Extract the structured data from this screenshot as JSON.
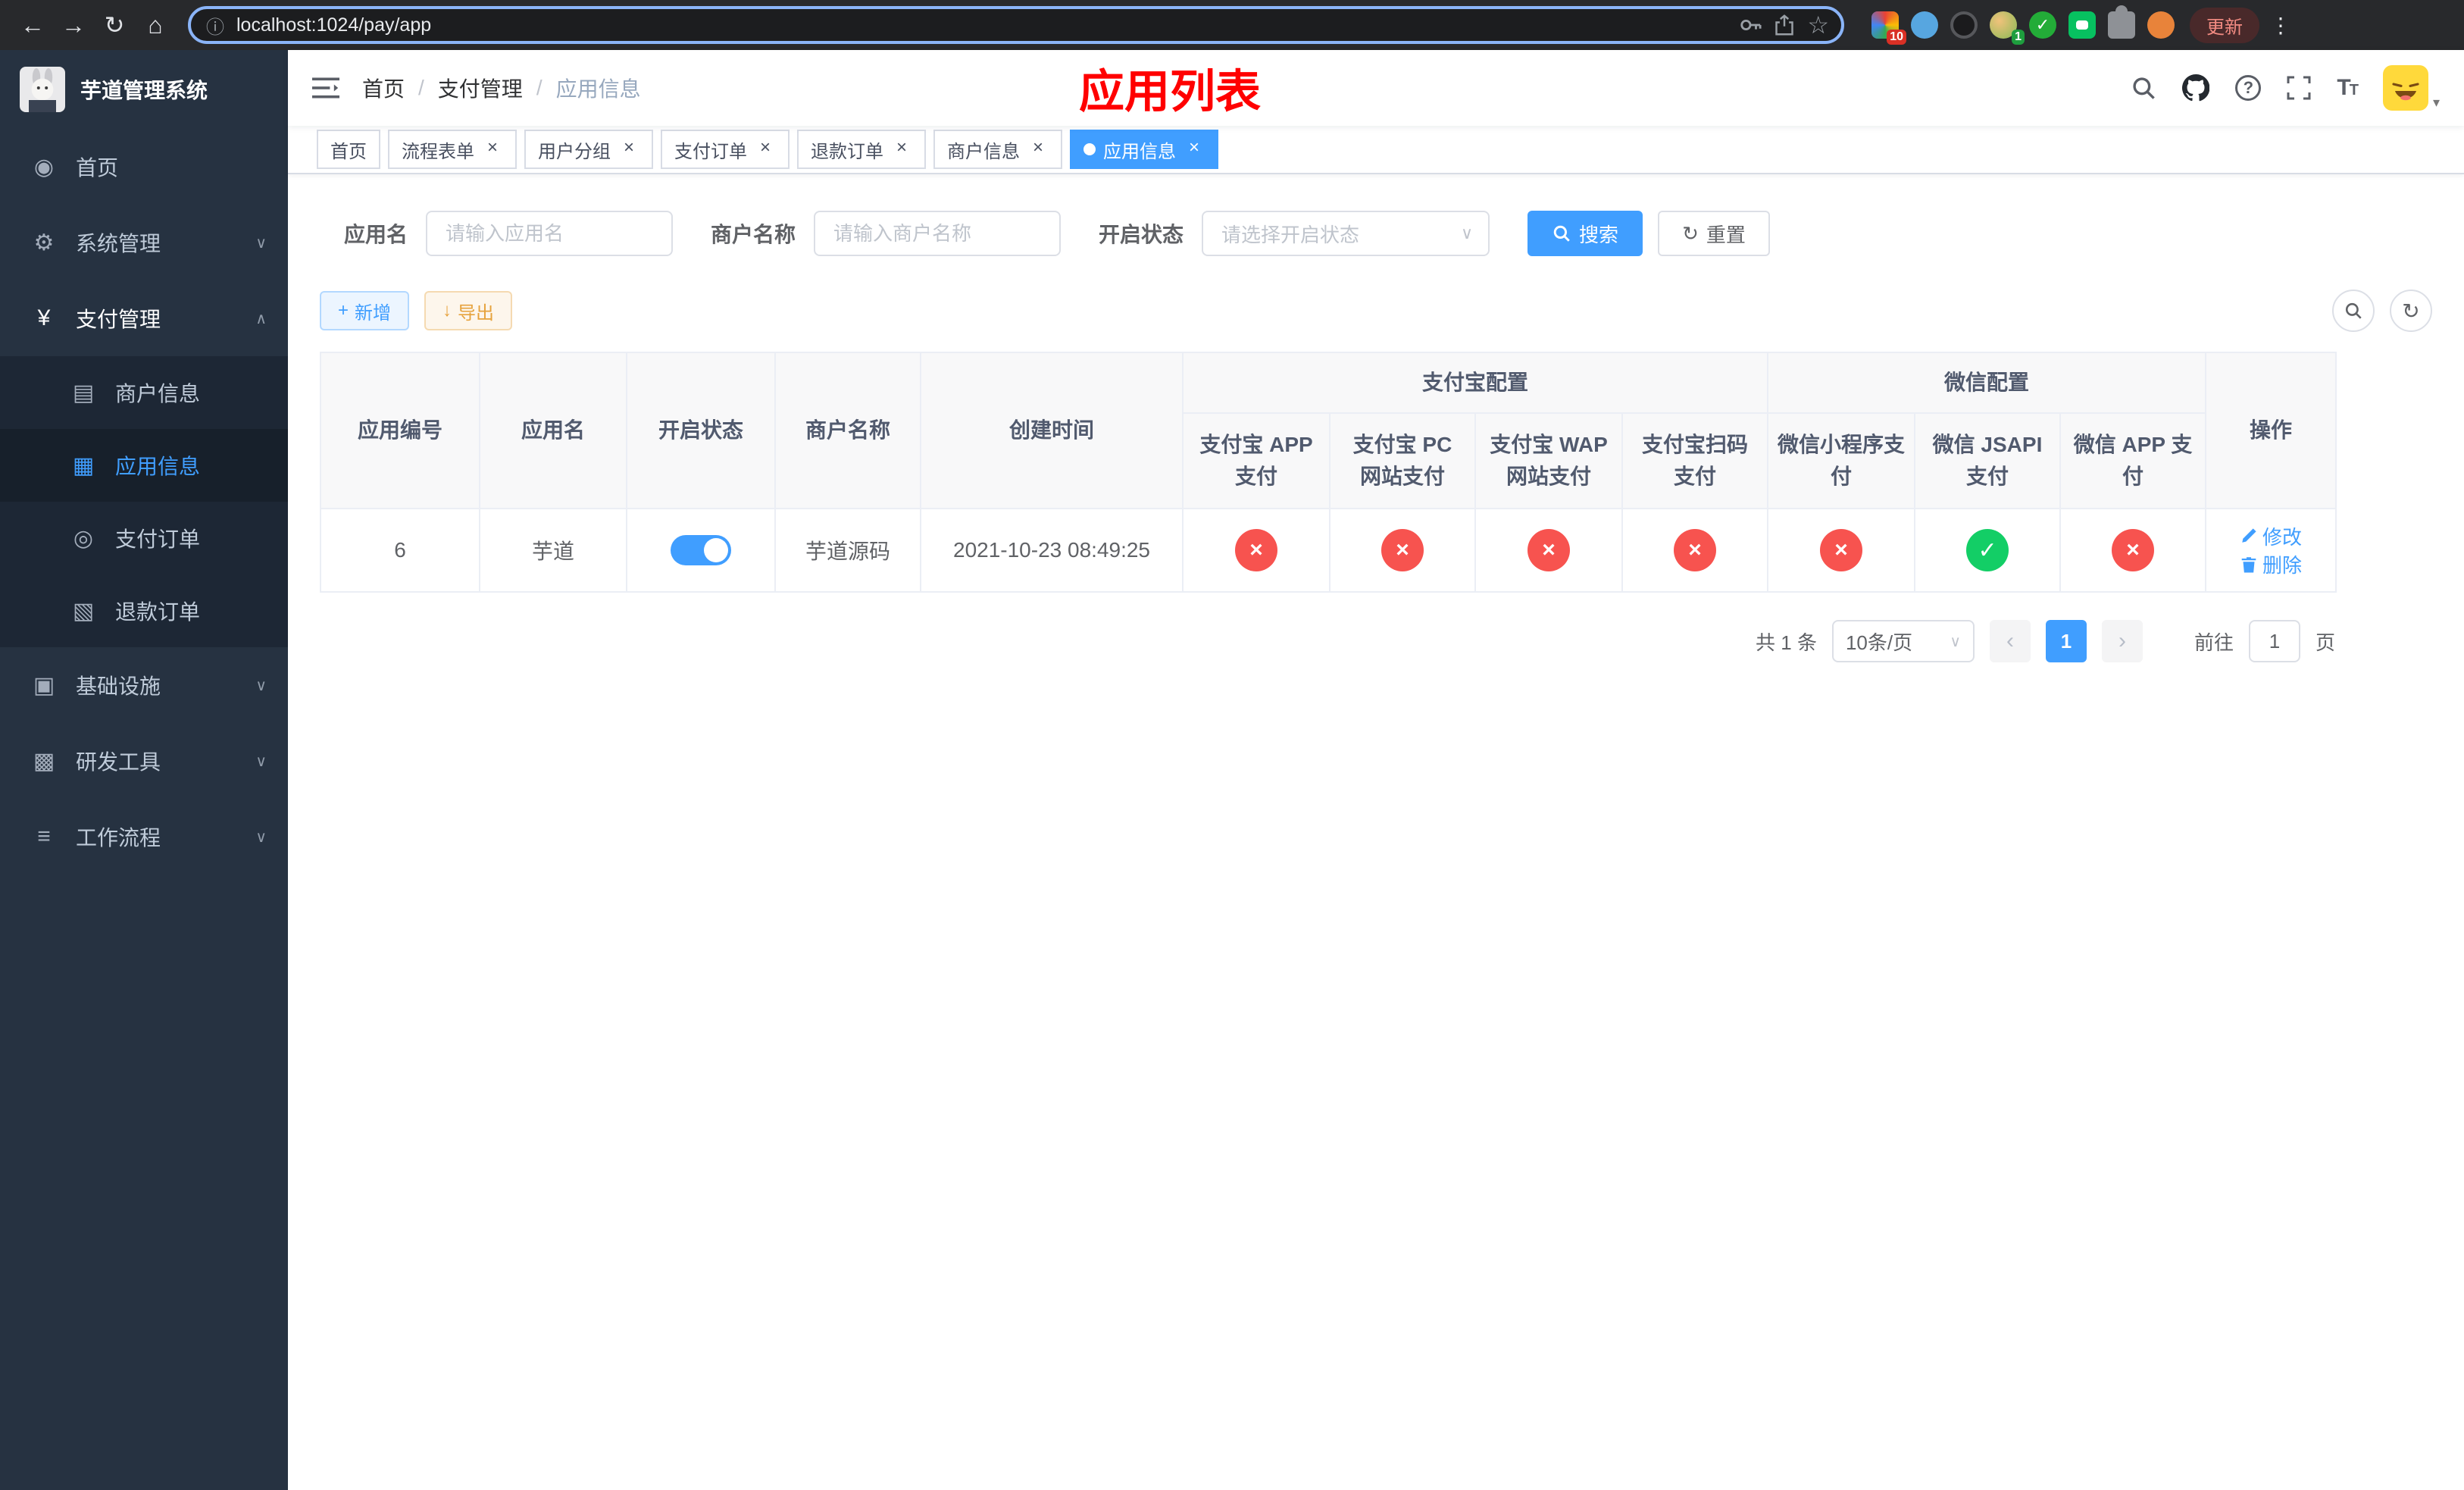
{
  "colors": {
    "primary": "#409eff",
    "danger": "#f7534f",
    "success": "#13ce66",
    "warning": "#e6a23c",
    "title_red": "#ff0000"
  },
  "icons": {
    "close": "×",
    "back": "←",
    "forward": "→",
    "reload": "↻",
    "home": "⌂",
    "info": "ⓘ",
    "star": "☆",
    "menu_dots": "⋮",
    "caret_down": "∨",
    "caret_up": "∧",
    "caret_small": "▾",
    "slash": "/",
    "dashboard": "◉",
    "system": "⚙",
    "pay": "¥",
    "merchant": "▤",
    "app": "▦",
    "order": "◎",
    "refund": "▧",
    "infra": "▣",
    "tool": "▩",
    "flow": "≡",
    "plus": "+",
    "download": "↓",
    "refresh": "↻",
    "check": "✓",
    "cross": "×",
    "question": "?",
    "prev": "‹",
    "next": "›"
  },
  "browser": {
    "url": "localhost:1024/pay/app",
    "update_label": "更新",
    "ext_badge_red": "10",
    "ext_badge_green": "1"
  },
  "sidebar": {
    "app_title": "芋道管理系统",
    "menu": [
      {
        "label": "首页"
      },
      {
        "label": "系统管理"
      },
      {
        "label": "支付管理"
      },
      {
        "label": "商户信息"
      },
      {
        "label": "应用信息"
      },
      {
        "label": "支付订单"
      },
      {
        "label": "退款订单"
      },
      {
        "label": "基础设施"
      },
      {
        "label": "研发工具"
      },
      {
        "label": "工作流程"
      }
    ]
  },
  "breadcrumb": {
    "home": "首页",
    "section": "支付管理",
    "current": "应用信息"
  },
  "header": {
    "title": "应用列表"
  },
  "tabs": [
    {
      "label": "首页"
    },
    {
      "label": "流程表单"
    },
    {
      "label": "用户分组"
    },
    {
      "label": "支付订单"
    },
    {
      "label": "退款订单"
    },
    {
      "label": "商户信息"
    },
    {
      "label": "应用信息"
    }
  ],
  "filters": {
    "app_name_label": "应用名",
    "app_name_placeholder": "请输入应用名",
    "merchant_label": "商户名称",
    "merchant_placeholder": "请输入商户名称",
    "status_label": "开启状态",
    "status_placeholder": "请选择开启状态",
    "search_label": "搜索",
    "reset_label": "重置"
  },
  "toolbar": {
    "add_label": "新增",
    "export_label": "导出"
  },
  "table": {
    "col_app_id": "应用编号",
    "col_app_name": "应用名",
    "col_status": "开启状态",
    "col_merchant": "商户名称",
    "col_created": "创建时间",
    "group_alipay": "支付宝配置",
    "group_wechat": "微信配置",
    "col_alipay_app": "支付宝 APP 支付",
    "col_alipay_pc": "支付宝 PC 网站支付",
    "col_alipay_wap": "支付宝 WAP 网站支付",
    "col_alipay_qr": "支付宝扫码支付",
    "col_wx_mini": "微信小程序支付",
    "col_wx_jsapi": "微信 JSAPI 支付",
    "col_wx_app": "微信 APP 支付",
    "col_ops": "操作",
    "rows": [
      {
        "id": "6",
        "name": "芋道",
        "enabled": true,
        "merchant": "芋道源码",
        "created": "2021-10-23 08:49:25",
        "alipay_app": false,
        "alipay_pc": false,
        "alipay_wap": false,
        "alipay_qr": false,
        "wx_mini": false,
        "wx_jsapi": true,
        "wx_app": false,
        "edit_label": "修改",
        "delete_label": "删除"
      }
    ]
  },
  "pagination": {
    "total": "共 1 条",
    "page_size": "10条/页",
    "page": "1",
    "goto_label": "前往",
    "goto_value": "1",
    "unit_label": "页"
  }
}
